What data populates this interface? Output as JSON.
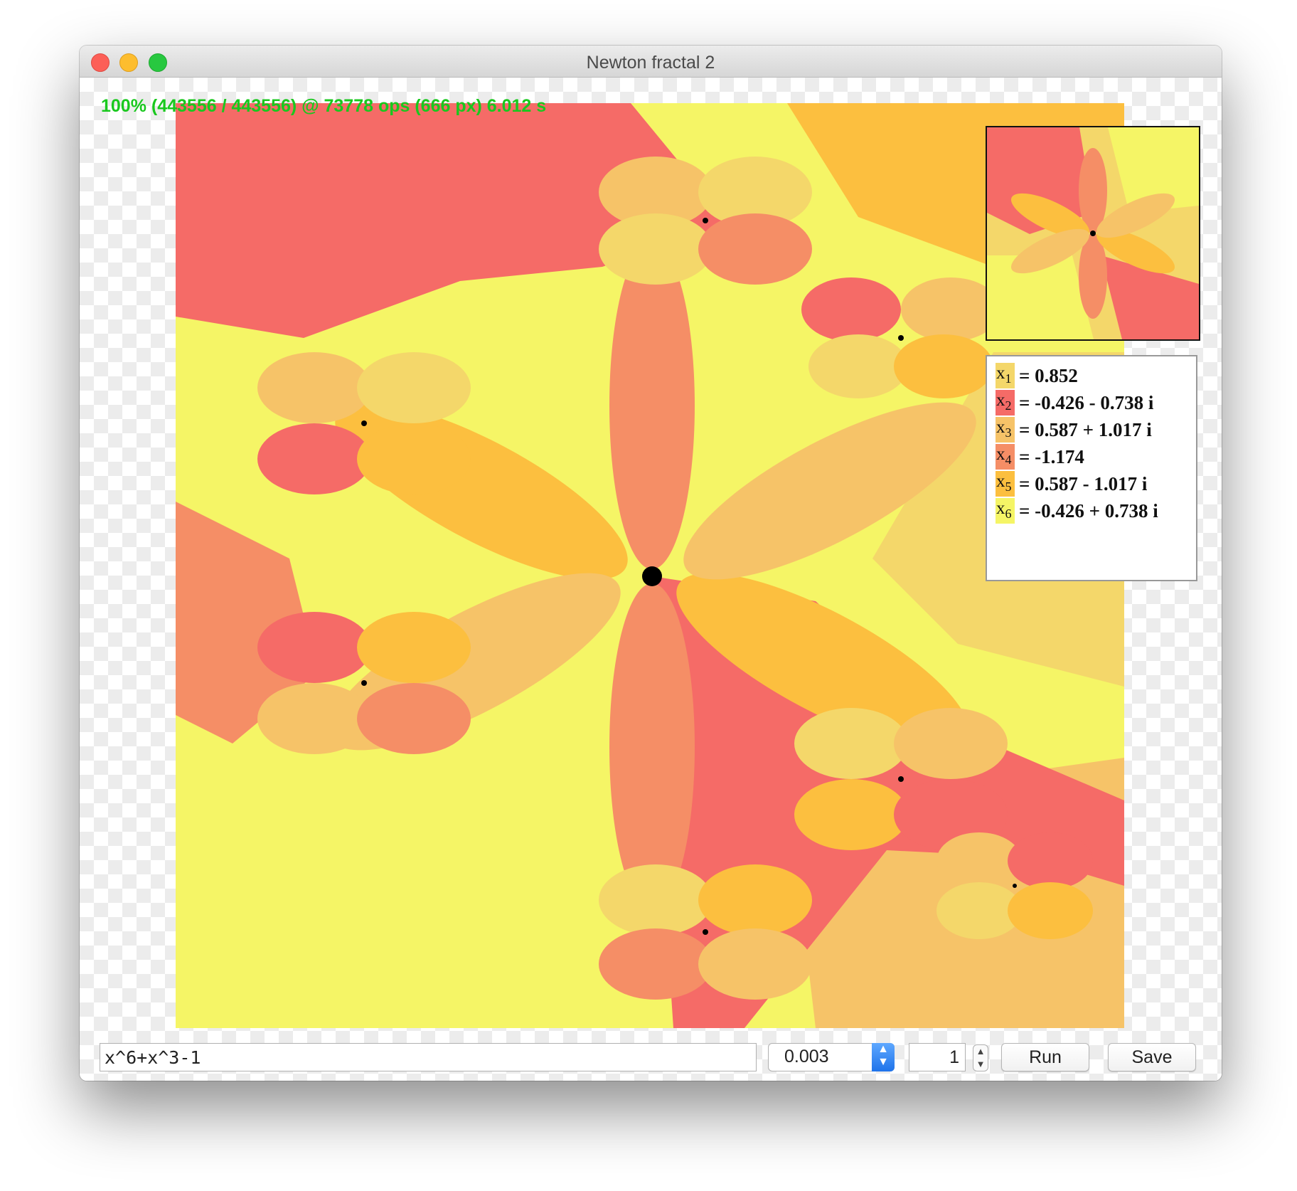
{
  "window": {
    "title": "Newton fractal 2"
  },
  "status": "100% (443556 / 443556) @ 73778 ops (666 px) 6.012 s",
  "roots": [
    {
      "var": "x",
      "sub": "1",
      "value": "= 0.852",
      "color": "#f4d76a"
    },
    {
      "var": "x",
      "sub": "2",
      "value": "= -0.426 - 0.738 i",
      "color": "#f56b67"
    },
    {
      "var": "x",
      "sub": "3",
      "value": "= 0.587 + 1.017 i",
      "color": "#f6c368"
    },
    {
      "var": "x",
      "sub": "4",
      "value": "= -1.174",
      "color": "#f58e66"
    },
    {
      "var": "x",
      "sub": "5",
      "value": "= 0.587 - 1.017 i",
      "color": "#fcbf3f"
    },
    {
      "var": "x",
      "sub": "6",
      "value": "= -0.426 + 0.738 i",
      "color": "#f5f566"
    }
  ],
  "controls": {
    "formula": "x^6+x^3-1",
    "tolerance": "0.003",
    "iterations": "1",
    "run_label": "Run",
    "save_label": "Save"
  },
  "icons": {
    "stepper": "up-down-chevron-icon",
    "select_arrow": "up-down-chevron-icon"
  },
  "colors": {
    "status_text": "#19c81e",
    "root_marker": "#000000"
  }
}
